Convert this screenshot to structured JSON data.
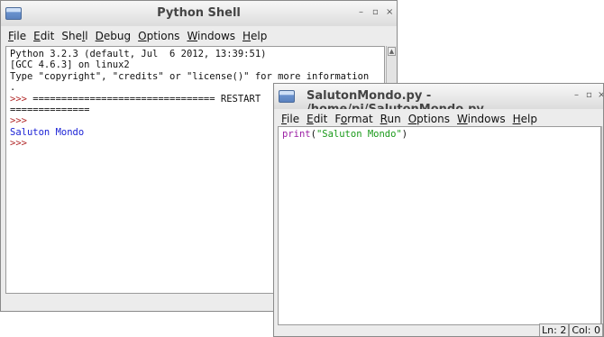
{
  "shell": {
    "title": "Python Shell",
    "controls": {
      "minimize": "–",
      "maximize": "▫",
      "close": "×"
    },
    "menu": [
      {
        "pre": "",
        "key": "F",
        "post": "ile"
      },
      {
        "pre": "",
        "key": "E",
        "post": "dit"
      },
      {
        "pre": "She",
        "key": "l",
        "post": "l"
      },
      {
        "pre": "",
        "key": "D",
        "post": "ebug"
      },
      {
        "pre": "",
        "key": "O",
        "post": "ptions"
      },
      {
        "pre": "",
        "key": "W",
        "post": "indows"
      },
      {
        "pre": "",
        "key": "H",
        "post": "elp"
      }
    ],
    "lines": [
      {
        "text": "Python 3.2.3 (default, Jul  6 2012, 13:39:51)",
        "color": "black"
      },
      {
        "text": "[GCC 4.6.3] on linux2",
        "color": "black"
      },
      {
        "text": "Type \"copyright\", \"credits\" or \"license()\" for more information",
        "color": "black"
      },
      {
        "text": ".",
        "color": "black"
      },
      {
        "text": ">>> ================================ RESTART",
        "color": "prompt_restart"
      },
      {
        "text": "==============",
        "color": "black"
      },
      {
        "text": ">>>",
        "color": "prompt"
      },
      {
        "text": "Saluton Mondo",
        "color": "blue"
      },
      {
        "text": ">>>",
        "color": "prompt"
      }
    ]
  },
  "editor": {
    "title": "SalutonMondo.py - /home/pi/SalutonMondo.py",
    "controls": {
      "minimize": "–",
      "maximize": "▫",
      "close": "×"
    },
    "menu": [
      {
        "pre": "",
        "key": "F",
        "post": "ile"
      },
      {
        "pre": "",
        "key": "E",
        "post": "dit"
      },
      {
        "pre": "F",
        "key": "o",
        "post": "rmat"
      },
      {
        "pre": "",
        "key": "R",
        "post": "un"
      },
      {
        "pre": "",
        "key": "O",
        "post": "ptions"
      },
      {
        "pre": "",
        "key": "W",
        "post": "indows"
      },
      {
        "pre": "",
        "key": "H",
        "post": "elp"
      }
    ],
    "code": {
      "keyword": "print",
      "open": "(",
      "string": "\"Saluton Mondo\"",
      "close": ")"
    },
    "status": {
      "line": "Ln: 2",
      "col": "Col: 0"
    }
  }
}
